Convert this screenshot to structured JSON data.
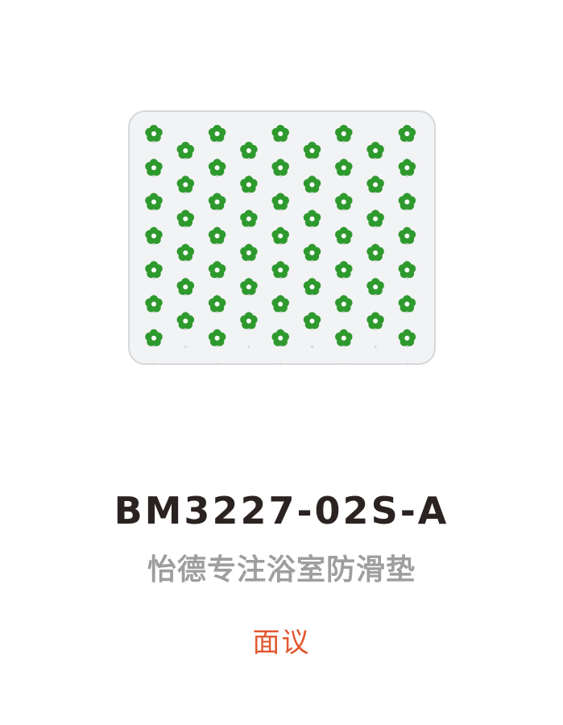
{
  "product": {
    "model_code": "BM3227-02S-A",
    "name": "怡德专注浴室防滑垫",
    "price_label": "面议"
  },
  "colors": {
    "model_code": "#2b2321",
    "name": "#9e9e9e",
    "price_label": "#e2572f",
    "flower": "#2e9a2e",
    "flower_center": "#ffffff",
    "mat": "#f2f3f4",
    "mat_border": "#d6d8db"
  },
  "mat": {
    "pattern_icon": "flower-icon",
    "flower_columns": 9,
    "flower_rows_odd": 7,
    "flower_rows_even": 6
  }
}
